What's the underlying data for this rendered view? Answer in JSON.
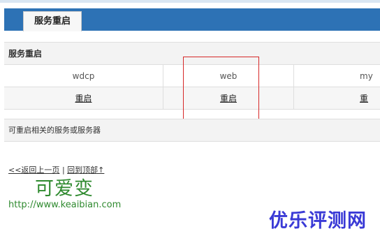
{
  "tab": {
    "label": "服务重启"
  },
  "section": {
    "title": "服务重启"
  },
  "services": [
    {
      "name": "wdcp",
      "action": "重启"
    },
    {
      "name": "web",
      "action": "重启"
    },
    {
      "name": "my",
      "action": "重"
    }
  ],
  "description": "可重启相关的服务或服务器",
  "footer": {
    "back": "<<返回上一页",
    "separator": "|",
    "top": "回到顶部↑"
  },
  "watermarks": {
    "cn": "可爱变",
    "url": "http://www.keaibian.com",
    "brand": "优乐评测网"
  },
  "colors": {
    "header": "#2d72b5",
    "highlight": "#d62828",
    "watermark_green": "#2f8a2f",
    "watermark_blue": "#3a3ad6"
  }
}
